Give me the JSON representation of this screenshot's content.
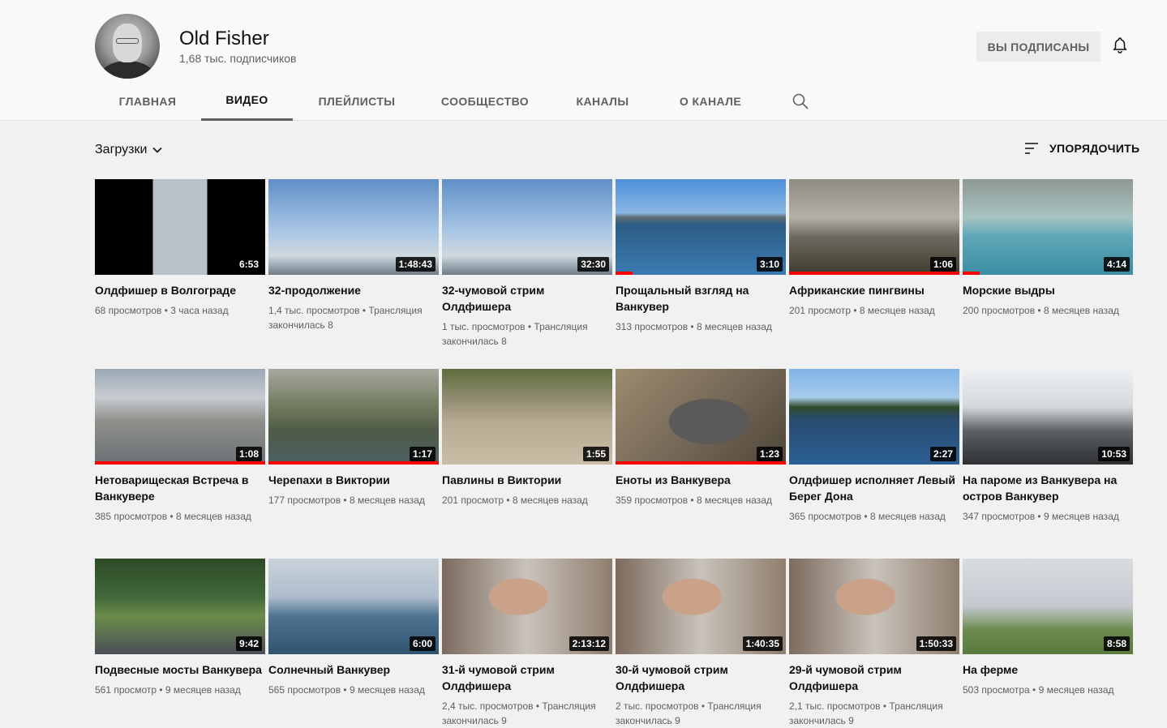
{
  "channel": {
    "name": "Old Fisher",
    "subscribers": "1,68 тыс. подписчиков",
    "subscribed_label": "ВЫ ПОДПИСАНЫ"
  },
  "tabs": [
    {
      "label": "ГЛАВНАЯ"
    },
    {
      "label": "ВИДЕО"
    },
    {
      "label": "ПЛЕЙЛИСТЫ"
    },
    {
      "label": "СООБЩЕСТВО"
    },
    {
      "label": "КАНАЛЫ"
    },
    {
      "label": "О КАНАЛЕ"
    }
  ],
  "active_tab": "ВИДЕО",
  "filter": {
    "label": "Загрузки"
  },
  "sort": {
    "label": "УПОРЯДОЧИТЬ"
  },
  "icons": [
    "avatar",
    "bell-icon",
    "search-icon",
    "chevron-down-icon",
    "sort-icon"
  ],
  "colors": {
    "progress": "#ff0000",
    "background": "#f1f1f1"
  },
  "videos": [
    {
      "title": "Олдфишер в Волгограде",
      "duration": "6:53",
      "views": "68 просмотров",
      "age": "3 часа назад",
      "watched": 0,
      "scene": "statue"
    },
    {
      "title": "32-продолжение",
      "duration": "1:48:43",
      "views": "1,4 тыс. просмотров",
      "age": "Трансляция закончилась 8",
      "watched": 0,
      "scene": "penguins"
    },
    {
      "title": "32-чумовой стрим Олдфишера",
      "duration": "32:30",
      "views": "1 тыс. просмотров",
      "age": "Трансляция закончилась 8",
      "watched": 0,
      "scene": "penguins"
    },
    {
      "title": "Прощальный взгляд на Ванкувер",
      "duration": "3:10",
      "views": "313 просмотров",
      "age": "8 месяцев назад",
      "watched": 0.1,
      "scene": "bay"
    },
    {
      "title": "Африканские пингвины",
      "duration": "1:06",
      "views": "201 просмотр",
      "age": "8 месяцев назад",
      "watched": 1,
      "scene": "rocks"
    },
    {
      "title": "Морские выдры",
      "duration": "4:14",
      "views": "200 просмотров",
      "age": "8 месяцев назад",
      "watched": 0.1,
      "scene": "pool"
    },
    {
      "title": "Нетоварищеская Встреча в Ванкувере",
      "duration": "1:08",
      "views": "385 просмотров",
      "age": "8 месяцев назад",
      "watched": 1,
      "scene": "marina"
    },
    {
      "title": "Черепахи в Виктории",
      "duration": "1:17",
      "views": "177 просмотров",
      "age": "8 месяцев назад",
      "watched": 1,
      "scene": "pond"
    },
    {
      "title": "Павлины в Виктории",
      "duration": "1:55",
      "views": "201 просмотр",
      "age": "8 месяцев назад",
      "watched": 0,
      "scene": "ground"
    },
    {
      "title": "Еноты из Ванкувера",
      "duration": "1:23",
      "views": "359 просмотров",
      "age": "8 месяцев назад",
      "watched": 1,
      "scene": "raccoon"
    },
    {
      "title": "Олдфишер исполняет Левый Берег Дона",
      "duration": "2:27",
      "views": "365 просмотров",
      "age": "8 месяцев назад",
      "watched": 0,
      "scene": "island"
    },
    {
      "title": "На пароме из Ванкувера на остров Ванкувер",
      "duration": "10:53",
      "views": "347 просмотров",
      "age": "9 месяцев назад",
      "watched": 0,
      "scene": "ferry"
    },
    {
      "title": "Подвесные мосты Ванкувера",
      "duration": "9:42",
      "views": "561 просмотр",
      "age": "9 месяцев назад",
      "watched": 0,
      "scene": "forest"
    },
    {
      "title": "Солнечный Ванкувер",
      "duration": "6:00",
      "views": "565 просмотров",
      "age": "9 месяцев назад",
      "watched": 0,
      "scene": "sea"
    },
    {
      "title": "31-й чумовой стрим Олдфишера",
      "duration": "2:13:12",
      "views": "2,4 тыс. просмотров",
      "age": "Трансляция закончилась 9",
      "watched": 0,
      "scene": "selfie"
    },
    {
      "title": "30-й чумовой стрим Олдфишера",
      "duration": "1:40:35",
      "views": "2 тыс. просмотров",
      "age": "Трансляция закончилась 9",
      "watched": 0,
      "scene": "selfie"
    },
    {
      "title": "29-й чумовой стрим Олдфишера",
      "duration": "1:50:33",
      "views": "2,1 тыс. просмотров",
      "age": "Трансляция закончилась 9",
      "watched": 0,
      "scene": "selfie"
    },
    {
      "title": "На ферме",
      "duration": "8:58",
      "views": "503 просмотра",
      "age": "9 месяцев назад",
      "watched": 0,
      "scene": "farm"
    }
  ]
}
